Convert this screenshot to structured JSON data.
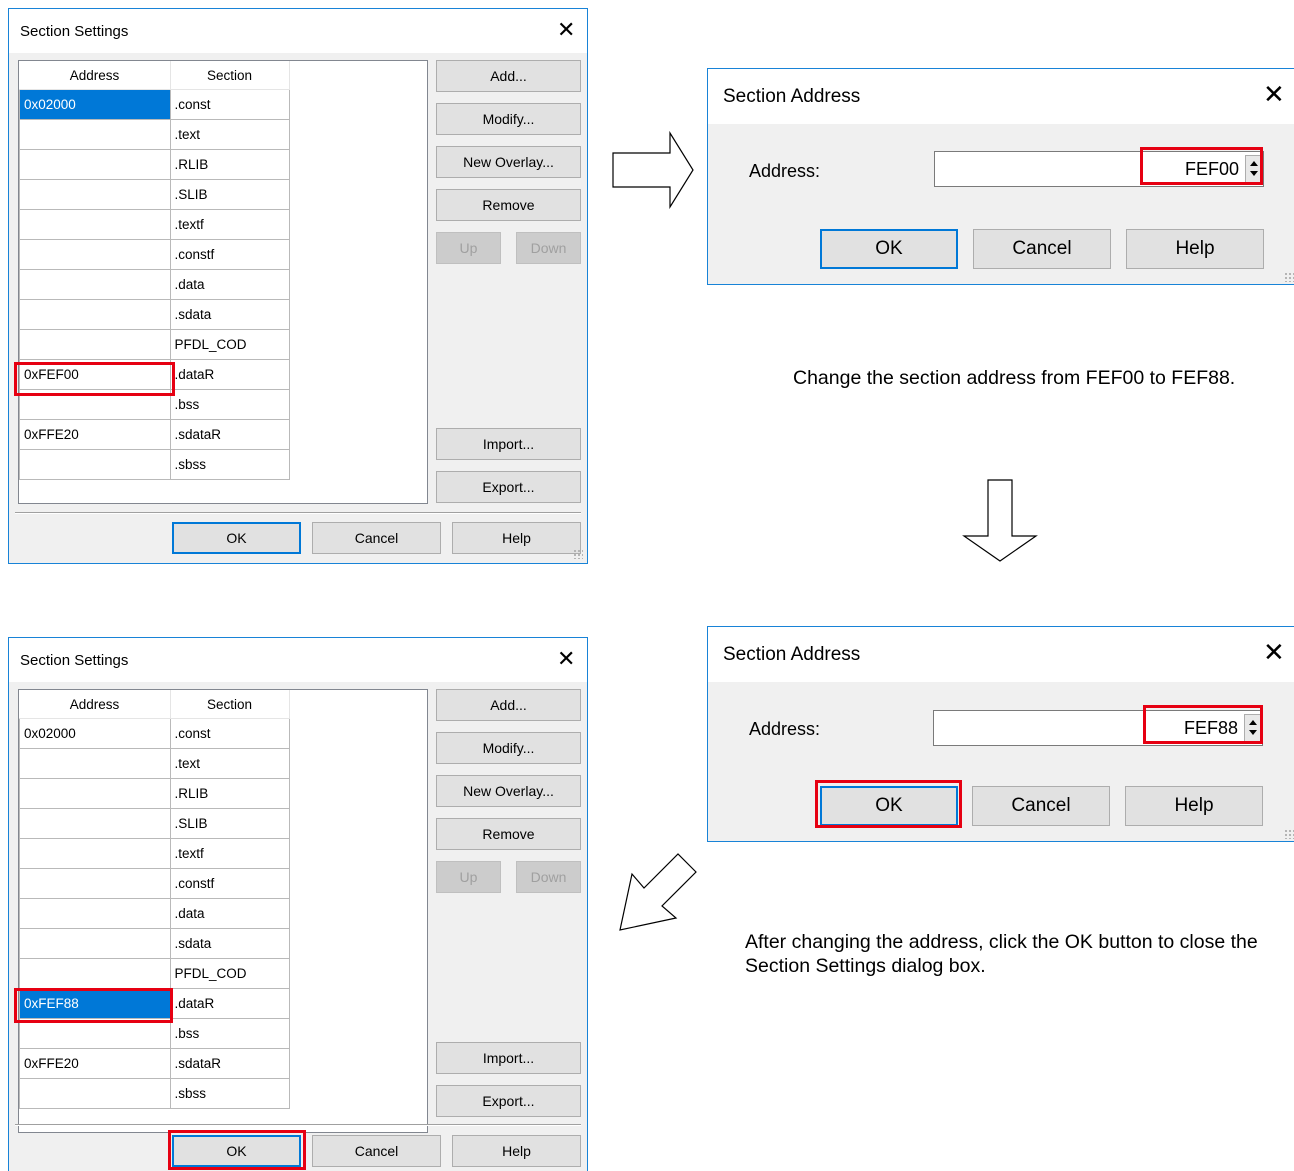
{
  "settings_dialog": {
    "title": "Section Settings",
    "col_address": "Address",
    "col_section": "Section",
    "btn_add": "Add...",
    "btn_modify": "Modify...",
    "btn_new_overlay": "New Overlay...",
    "btn_remove": "Remove",
    "btn_up": "Up",
    "btn_down": "Down",
    "btn_import": "Import...",
    "btn_export": "Export...",
    "btn_ok": "OK",
    "btn_cancel": "Cancel",
    "btn_help": "Help"
  },
  "before_rows": [
    {
      "address": "0x02000",
      "section": ".const"
    },
    {
      "address": "",
      "section": ".text"
    },
    {
      "address": "",
      "section": ".RLIB"
    },
    {
      "address": "",
      "section": ".SLIB"
    },
    {
      "address": "",
      "section": ".textf"
    },
    {
      "address": "",
      "section": ".constf"
    },
    {
      "address": "",
      "section": ".data"
    },
    {
      "address": "",
      "section": ".sdata"
    },
    {
      "address": "",
      "section": "PFDL_COD"
    },
    {
      "address": "0xFEF00",
      "section": ".dataR"
    },
    {
      "address": "",
      "section": ".bss"
    },
    {
      "address": "0xFFE20",
      "section": ".sdataR"
    },
    {
      "address": "",
      "section": ".sbss"
    }
  ],
  "after_rows": [
    {
      "address": "0x02000",
      "section": ".const"
    },
    {
      "address": "",
      "section": ".text"
    },
    {
      "address": "",
      "section": ".RLIB"
    },
    {
      "address": "",
      "section": ".SLIB"
    },
    {
      "address": "",
      "section": ".textf"
    },
    {
      "address": "",
      "section": ".constf"
    },
    {
      "address": "",
      "section": ".data"
    },
    {
      "address": "",
      "section": ".sdata"
    },
    {
      "address": "",
      "section": "PFDL_COD"
    },
    {
      "address": "0xFEF88",
      "section": ".dataR"
    },
    {
      "address": "",
      "section": ".bss"
    },
    {
      "address": "0xFFE20",
      "section": ".sdataR"
    },
    {
      "address": "",
      "section": ".sbss"
    }
  ],
  "address_dialog": {
    "title": "Section Address",
    "label": "Address:",
    "btn_ok": "OK",
    "btn_cancel": "Cancel",
    "btn_help": "Help"
  },
  "address_values": {
    "before": "FEF00",
    "after": "FEF88"
  },
  "caption_change": "Change the section address from FEF00 to FEF88.",
  "caption_after": "After changing the address, click the OK button to close the Section Settings dialog box.",
  "colors": {
    "accent": "#0078d7",
    "highlight": "#e60012",
    "selection": "#0078d7"
  }
}
